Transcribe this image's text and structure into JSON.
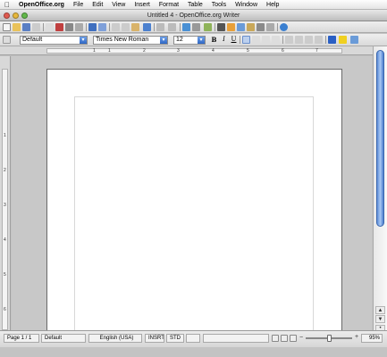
{
  "menubar": {
    "apple_icon": "apple-icon",
    "app_name": "OpenOffice.org",
    "items": [
      "File",
      "Edit",
      "View",
      "Insert",
      "Format",
      "Table",
      "Tools",
      "Window",
      "Help"
    ]
  },
  "window": {
    "title": "Untitled 4 - OpenOffice.org Writer",
    "controls": {
      "close_color": "#e05a4f",
      "minimize_color": "#e6b73b",
      "zoom_color": "#62b84a"
    }
  },
  "formatting": {
    "style": "Default",
    "font": "Times New Roman",
    "size": "12",
    "bold_label": "B",
    "italic_label": "I",
    "underline_label": "U"
  },
  "ruler_numbers": {
    "horizontal": [
      "1",
      "1",
      "2",
      "3",
      "4",
      "5",
      "6",
      "7"
    ],
    "vertical": [
      "1",
      "2",
      "3",
      "4",
      "5",
      "6"
    ]
  },
  "statusbar": {
    "page": "Page 1 / 1",
    "style": "Default",
    "language": "English (USA)",
    "insert_mode": "INSRT",
    "selection_mode": "STD",
    "zoom": "95%"
  },
  "zoom_level": 0.5,
  "colors": {
    "accent": "#2f67c6",
    "scroll_thumb": "#5d8ed9"
  }
}
